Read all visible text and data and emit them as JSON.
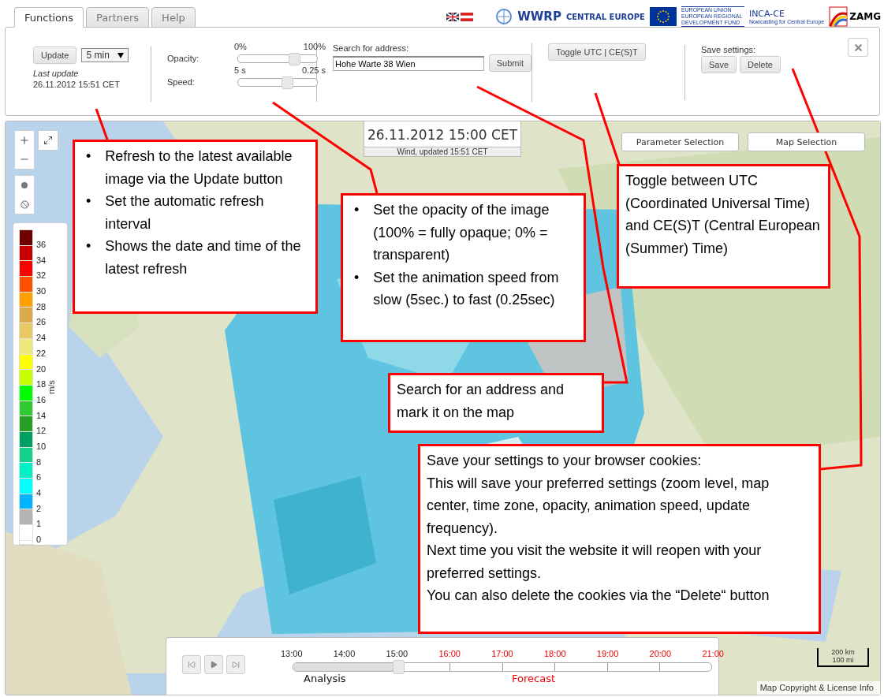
{
  "tabs": [
    {
      "label": "Functions",
      "selected": true
    },
    {
      "label": "Partners",
      "selected": false
    },
    {
      "label": "Help",
      "selected": false
    }
  ],
  "flags": [
    {
      "kind": "uk"
    },
    {
      "kind": "at"
    }
  ],
  "logos": [
    {
      "kind": "emblem"
    },
    {
      "kind": "wordmark",
      "text": "WWRP"
    },
    {
      "kind": "wordmark",
      "text": "CENTRAL EUROPE"
    },
    {
      "kind": "eu_flag"
    },
    {
      "kind": "smallprint",
      "text": "EUROPEAN UNION EUROPEAN REGIONAL DEVELOPMENT FUND"
    },
    {
      "kind": "inca",
      "text": "INCA-CE",
      "subtitle": "Nowcasting for Central Europe"
    },
    {
      "kind": "zamg",
      "text": "ZAMG"
    }
  ],
  "toolbar": {
    "update_button": "Update",
    "interval": "5 min",
    "last_update_label": "Last update",
    "last_update": "26.11.2012 15:51 CET",
    "opacity": {
      "label": "Opacity:",
      "min": "0%",
      "max": "100%",
      "level": 0.71
    },
    "speed": {
      "label": "Speed:",
      "min": "5 s",
      "max": "0.25 s",
      "level": 0.62
    },
    "search": {
      "label": "Search for address:",
      "value": "Hohe Warte 38 Wien",
      "button": "Submit"
    },
    "toggle_button": "Toggle UTC | CE(S)T",
    "save": {
      "label": "Save settings:",
      "save_button": "Save",
      "delete_button": "Delete"
    }
  },
  "map": {
    "timestamp": "26.11.2012 15:00 CET",
    "subtitle": "Wind, updated 15:51 CET",
    "buttons": [
      "Parameter Selection",
      "Map Selection"
    ],
    "legend": {
      "unit": "m/s",
      "items": [
        {
          "color": "#6e0000",
          "label": "36"
        },
        {
          "color": "#c80000",
          "label": "34"
        },
        {
          "color": "#ff0000",
          "label": "32"
        },
        {
          "color": "#ff5000",
          "label": "30"
        },
        {
          "color": "#ffa000",
          "label": "28"
        },
        {
          "color": "#dca84c",
          "label": "26"
        },
        {
          "color": "#e6c864",
          "label": "24"
        },
        {
          "color": "#ece87c",
          "label": "22"
        },
        {
          "color": "#ffff00",
          "label": "20"
        },
        {
          "color": "#c8ff00",
          "label": "18"
        },
        {
          "color": "#00ff00",
          "label": "16"
        },
        {
          "color": "#32c832",
          "label": "14"
        },
        {
          "color": "#28a028",
          "label": "12"
        },
        {
          "color": "#00a064",
          "label": "10"
        },
        {
          "color": "#14d28c",
          "label": "8"
        },
        {
          "color": "#00f0c8",
          "label": "6"
        },
        {
          "color": "#00ffff",
          "label": "4"
        },
        {
          "color": "#00b4ff",
          "label": "2"
        },
        {
          "color": "#b4b4b4",
          "label": "1"
        },
        {
          "color": "#ffffff",
          "label": "0"
        }
      ]
    },
    "timeline": {
      "level": 0.25,
      "ticks": [
        {
          "label": "13:00",
          "kind": "analysis"
        },
        {
          "label": "14:00",
          "kind": "analysis"
        },
        {
          "label": "15:00",
          "kind": "analysis"
        },
        {
          "label": "16:00",
          "kind": "forecast"
        },
        {
          "label": "17:00",
          "kind": "forecast"
        },
        {
          "label": "18:00",
          "kind": "forecast"
        },
        {
          "label": "19:00",
          "kind": "forecast"
        },
        {
          "label": "20:00",
          "kind": "forecast"
        },
        {
          "label": "21:00",
          "kind": "forecast"
        }
      ],
      "analysis": "Analysis",
      "forecast": "Forecast"
    },
    "scale": {
      "km": "200 km",
      "mi": "100 mi"
    },
    "copyright": "Map Copyright & License Info"
  },
  "callouts": [
    {
      "kind": "bullets",
      "marker": "•",
      "items": [
        "Refresh to the latest available image via the Update button",
        "Set the automatic refresh interval",
        "Shows the date and time of the latest refresh"
      ]
    },
    {
      "kind": "bullets",
      "marker": "•",
      "items": [
        "Set the opacity of the image (100% = fully opaque; 0% = transparent)",
        "Set the animation speed from slow (5sec.) to fast (0.25sec)"
      ]
    },
    {
      "kind": "paragraph",
      "lines": [
        "Toggle between UTC (Coordinated Universal Time) and CE(S)T (Central European (Summer) Time)"
      ]
    },
    {
      "kind": "paragraph",
      "lines": [
        "Search for an address and mark it on the map"
      ]
    },
    {
      "kind": "paragraph",
      "lines": [
        "Save your settings to your browser cookies:",
        "This will save your preferred settings (zoom level, map center, time zone, opacity, animation speed, update frequency).",
        "Next time you visit the website it will reopen with your preferred settings.",
        "You can also delete the cookies via the “Delete“ button"
      ]
    }
  ]
}
